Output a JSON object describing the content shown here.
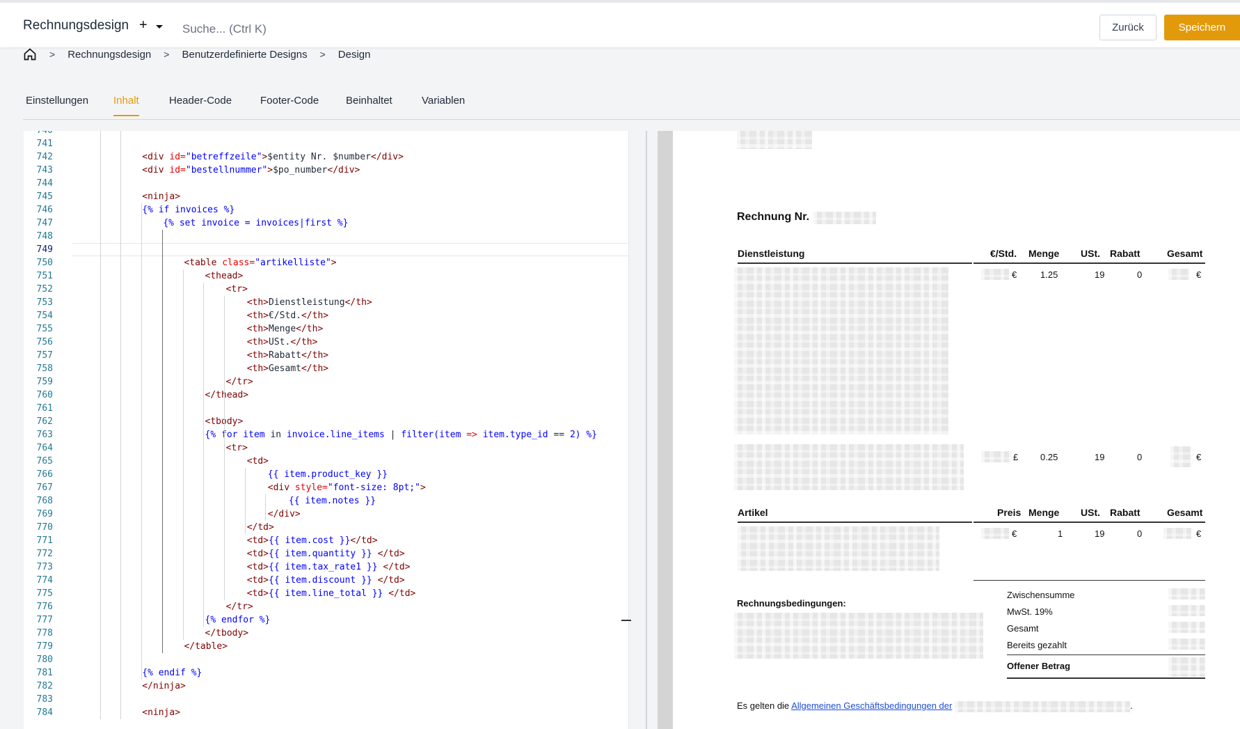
{
  "header": {
    "title": "Rechnungsdesign",
    "quick_add": "+",
    "search_placeholder": "Suche... (Ctrl K)",
    "back_label": "Zurück",
    "save_label": "Speichern"
  },
  "breadcrumb": {
    "items": [
      "Rechnungsdesign",
      "Benutzerdefinierte Designs",
      "Design"
    ],
    "separator": ">"
  },
  "tabs": [
    {
      "label": "Einstellungen",
      "active": false
    },
    {
      "label": "Inhalt",
      "active": true
    },
    {
      "label": "Header-Code",
      "active": false
    },
    {
      "label": "Footer-Code",
      "active": false
    },
    {
      "label": "Beinhaltet",
      "active": false
    },
    {
      "label": "Variablen",
      "active": false
    }
  ],
  "editor": {
    "first_line": 740,
    "current_line": 749,
    "lines": [
      {
        "n": "740",
        "indent": 0,
        "html": ""
      },
      {
        "n": "741",
        "indent": 0,
        "html": ""
      },
      {
        "n": "742",
        "indent": 3,
        "html": "<span class='tag'>&lt;div </span><span class='attr'>id=</span><span class='str'>\"betreffzeile\"</span><span class='tag'>&gt;</span>$entity Nr. $number<span class='tag'>&lt;/div&gt;</span>"
      },
      {
        "n": "743",
        "indent": 3,
        "html": "<span class='tag'>&lt;div </span><span class='attr'>id=</span><span class='str'>\"bestellnummer\"</span><span class='tag'>&gt;</span>$po_number<span class='tag'>&lt;/div&gt;</span>"
      },
      {
        "n": "744",
        "indent": 0,
        "html": ""
      },
      {
        "n": "745",
        "indent": 3,
        "html": "<span class='tag'>&lt;ninja&gt;</span>"
      },
      {
        "n": "746",
        "indent": 3,
        "html": "<span class='tpl'>{% if invoices %}</span>"
      },
      {
        "n": "747",
        "indent": 4,
        "html": "<span class='tpl'>{% set invoice = invoices|first %}</span>"
      },
      {
        "n": "748",
        "indent": 0,
        "html": ""
      },
      {
        "n": "749",
        "indent": 0,
        "html": ""
      },
      {
        "n": "750",
        "indent": 5,
        "html": "<span class='tag'>&lt;table </span><span class='attr'>class=</span><span class='str'>\"artikelliste\"</span><span class='tag'>&gt;</span>"
      },
      {
        "n": "751",
        "indent": 6,
        "html": "<span class='tag'>&lt;thead&gt;</span>"
      },
      {
        "n": "752",
        "indent": 7,
        "html": "<span class='tag'>&lt;tr&gt;</span>"
      },
      {
        "n": "753",
        "indent": 8,
        "html": "<span class='tag'>&lt;th&gt;</span>Dienstleistung<span class='tag'>&lt;/th&gt;</span>"
      },
      {
        "n": "754",
        "indent": 8,
        "html": "<span class='tag'>&lt;th&gt;</span>€/Std.<span class='tag'>&lt;/th&gt;</span>"
      },
      {
        "n": "755",
        "indent": 8,
        "html": "<span class='tag'>&lt;th&gt;</span>Menge<span class='tag'>&lt;/th&gt;</span>"
      },
      {
        "n": "756",
        "indent": 8,
        "html": "<span class='tag'>&lt;th&gt;</span>USt.<span class='tag'>&lt;/th&gt;</span>"
      },
      {
        "n": "757",
        "indent": 8,
        "html": "<span class='tag'>&lt;th&gt;</span>Rabatt<span class='tag'>&lt;/th&gt;</span>"
      },
      {
        "n": "758",
        "indent": 8,
        "html": "<span class='tag'>&lt;th&gt;</span>Gesamt<span class='tag'>&lt;/th&gt;</span>"
      },
      {
        "n": "759",
        "indent": 7,
        "html": "<span class='tag'>&lt;/tr&gt;</span>"
      },
      {
        "n": "760",
        "indent": 6,
        "html": "<span class='tag'>&lt;/thead&gt;</span>"
      },
      {
        "n": "761",
        "indent": 0,
        "html": ""
      },
      {
        "n": "762",
        "indent": 6,
        "html": "<span class='tag'>&lt;tbody&gt;</span>"
      },
      {
        "n": "763",
        "indent": 6,
        "html": "<span class='tpl'>{% for item </span>in <span class='tpl'>invoice.line_items </span>| <span class='tpl'>filter(item </span><span class='attr'>=&gt;</span> <span class='tpl'>item.type_id </span>== <span class='tpl'>2) %}</span>"
      },
      {
        "n": "764",
        "indent": 7,
        "html": "<span class='tag'>&lt;tr&gt;</span>"
      },
      {
        "n": "765",
        "indent": 8,
        "html": "<span class='tag'>&lt;td&gt;</span>"
      },
      {
        "n": "766",
        "indent": 9,
        "html": "<span class='tpl'>{{ item.product_key }}</span>"
      },
      {
        "n": "767",
        "indent": 9,
        "html": "<span class='tag'>&lt;div </span><span class='attr'>style=</span><span class='str'>\"font-size: 8pt;\"</span><span class='tag'>&gt;</span>"
      },
      {
        "n": "768",
        "indent": 10,
        "html": "<span class='tpl'>{{ item.notes }}</span>"
      },
      {
        "n": "769",
        "indent": 9,
        "html": "<span class='tag'>&lt;/div&gt;</span>"
      },
      {
        "n": "770",
        "indent": 8,
        "html": "<span class='tag'>&lt;/td&gt;</span>"
      },
      {
        "n": "771",
        "indent": 8,
        "html": "<span class='tag'>&lt;td&gt;</span><span class='tpl'>{{ item.cost }}</span><span class='tag'>&lt;/td&gt;</span>"
      },
      {
        "n": "772",
        "indent": 8,
        "html": "<span class='tag'>&lt;td&gt;</span><span class='tpl'>{{ item.quantity }}</span> <span class='tag'>&lt;/td&gt;</span>"
      },
      {
        "n": "773",
        "indent": 8,
        "html": "<span class='tag'>&lt;td&gt;</span><span class='tpl'>{{ item.tax_rate1 }}</span> <span class='tag'>&lt;/td&gt;</span>"
      },
      {
        "n": "774",
        "indent": 8,
        "html": "<span class='tag'>&lt;td&gt;</span><span class='tpl'>{{ item.discount }}</span> <span class='tag'>&lt;/td&gt;</span>"
      },
      {
        "n": "775",
        "indent": 8,
        "html": "<span class='tag'>&lt;td&gt;</span><span class='tpl'>{{ item.line_total }}</span> <span class='tag'>&lt;/td&gt;</span>"
      },
      {
        "n": "776",
        "indent": 7,
        "html": "<span class='tag'>&lt;/tr&gt;</span>"
      },
      {
        "n": "777",
        "indent": 6,
        "html": "<span class='tpl'>{% endfor %}</span>"
      },
      {
        "n": "778",
        "indent": 6,
        "html": "<span class='tag'>&lt;/tbody&gt;</span>"
      },
      {
        "n": "779",
        "indent": 5,
        "html": "<span class='tag'>&lt;/table&gt;</span>"
      },
      {
        "n": "780",
        "indent": 0,
        "html": ""
      },
      {
        "n": "781",
        "indent": 3,
        "html": "<span class='tpl'>{% endif %}</span>"
      },
      {
        "n": "782",
        "indent": 3,
        "html": "<span class='tag'>&lt;/ninja&gt;</span>"
      },
      {
        "n": "783",
        "indent": 0,
        "html": ""
      },
      {
        "n": "784",
        "indent": 3,
        "html": "<span class='tag'>&lt;ninja&gt;</span>"
      }
    ]
  },
  "preview": {
    "invoice_title": "Rechnung Nr.",
    "services_table": {
      "headers": [
        "Dienstleistung",
        "€/Std.",
        "Menge",
        "USt.",
        "Rabatt",
        "Gesamt"
      ],
      "rows": [
        {
          "unit": "€",
          "qty": "1.25",
          "tax": "19",
          "discount": "0",
          "total": "€"
        },
        {
          "unit": "£",
          "qty": "0.25",
          "tax": "19",
          "discount": "0",
          "total": "€"
        }
      ]
    },
    "articles_table": {
      "headers": [
        "Artikel",
        "Preis",
        "Menge",
        "USt.",
        "Rabatt",
        "Gesamt"
      ],
      "rows": [
        {
          "unit": "€",
          "qty": "1",
          "tax": "19",
          "discount": "0",
          "total": "€"
        }
      ]
    },
    "terms_label": "Rechnungsbedingungen:",
    "summary": {
      "subtotal": "Zwischensumme",
      "tax": "MwSt. 19%",
      "total": "Gesamt",
      "paid": "Bereits gezahlt",
      "balance": "Offener Betrag"
    },
    "footer_prefix": "Es gelten die ",
    "footer_link": "Allgemeinen Geschäftsbedingungen der",
    "footer_suffix": "."
  }
}
